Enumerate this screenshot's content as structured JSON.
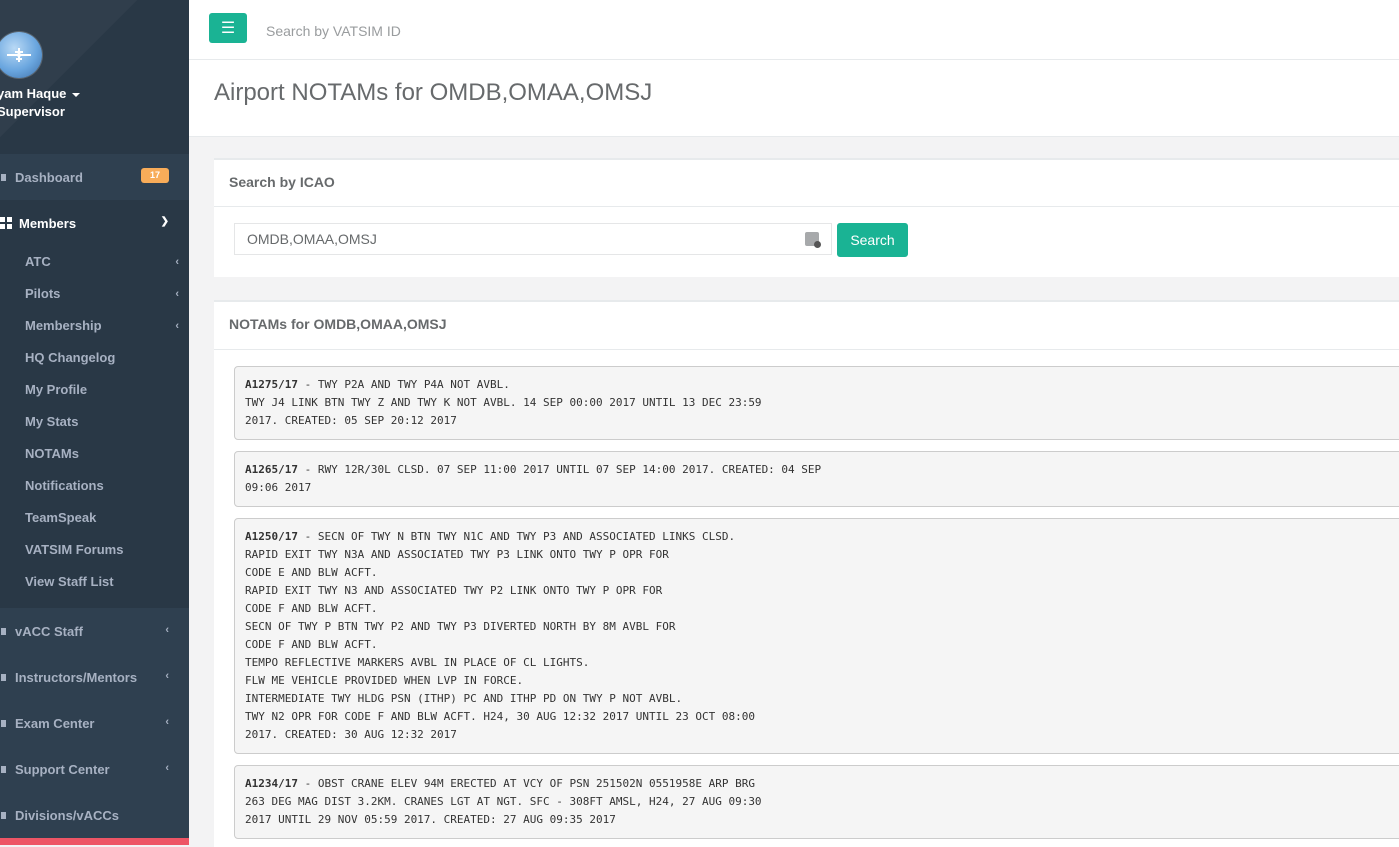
{
  "user": {
    "name": "yam Haque",
    "role": "Supervisor"
  },
  "sidebar": {
    "dashboard": {
      "label": "Dashboard",
      "badge": "17"
    },
    "members": {
      "label": "Members"
    },
    "members_items": [
      {
        "label": "ATC",
        "has_submenu": true
      },
      {
        "label": "Pilots",
        "has_submenu": true
      },
      {
        "label": "Membership",
        "has_submenu": true
      },
      {
        "label": "HQ Changelog",
        "has_submenu": false
      },
      {
        "label": "My Profile",
        "has_submenu": false
      },
      {
        "label": "My Stats",
        "has_submenu": false
      },
      {
        "label": "NOTAMs",
        "has_submenu": false
      },
      {
        "label": "Notifications",
        "has_submenu": false
      },
      {
        "label": "TeamSpeak",
        "has_submenu": false
      },
      {
        "label": "VATSIM Forums",
        "has_submenu": false
      },
      {
        "label": "View Staff List",
        "has_submenu": false
      }
    ],
    "sections": [
      {
        "label": "vACC Staff"
      },
      {
        "label": "Instructors/Mentors"
      },
      {
        "label": "Exam Center"
      },
      {
        "label": "Support Center"
      },
      {
        "label": "Divisions/vACCs"
      }
    ]
  },
  "topbar": {
    "search_placeholder": "Search by VATSIM ID"
  },
  "page": {
    "title": "Airport NOTAMs for OMDB,OMAA,OMSJ"
  },
  "search_panel": {
    "title": "Search by ICAO",
    "input_value": "OMDB,OMAA,OMSJ",
    "button_label": "Search"
  },
  "notam_panel": {
    "title": "NOTAMs for OMDB,OMAA,OMSJ",
    "notams": [
      {
        "id": "A1275/17",
        "text": " - TWY P2A AND TWY P4A NOT AVBL.\nTWY J4 LINK BTN TWY Z AND TWY K NOT AVBL. 14 SEP 00:00 2017 UNTIL 13 DEC 23:59\n2017. CREATED: 05 SEP 20:12 2017"
      },
      {
        "id": "A1265/17",
        "text": " - RWY 12R/30L CLSD. 07 SEP 11:00 2017 UNTIL 07 SEP 14:00 2017. CREATED: 04 SEP\n09:06 2017"
      },
      {
        "id": "A1250/17",
        "text": " - SECN OF TWY N BTN TWY N1C AND TWY P3 AND ASSOCIATED LINKS CLSD.\nRAPID EXIT TWY N3A AND ASSOCIATED TWY P3 LINK ONTO TWY P OPR FOR\nCODE E AND BLW ACFT.\nRAPID EXIT TWY N3 AND ASSOCIATED TWY P2 LINK ONTO TWY P OPR FOR\nCODE F AND BLW ACFT.\nSECN OF TWY P BTN TWY P2 AND TWY P3 DIVERTED NORTH BY 8M AVBL FOR\nCODE F AND BLW ACFT.\nTEMPO REFLECTIVE MARKERS AVBL IN PLACE OF CL LIGHTS.\nFLW ME VEHICLE PROVIDED WHEN LVP IN FORCE.\nINTERMEDIATE TWY HLDG PSN (ITHP) PC AND ITHP PD ON TWY P NOT AVBL.\nTWY N2 OPR FOR CODE F AND BLW ACFT. H24, 30 AUG 12:32 2017 UNTIL 23 OCT 08:00\n2017. CREATED: 30 AUG 12:32 2017"
      },
      {
        "id": "A1234/17",
        "text": " - OBST CRANE ELEV 94M ERECTED AT VCY OF PSN 251502N 0551958E ARP BRG\n263 DEG MAG DIST 3.2KM. CRANES LGT AT NGT. SFC - 308FT AMSL, H24, 27 AUG 09:30\n2017 UNTIL 29 NOV 05:59 2017. CREATED: 27 AUG 09:35 2017"
      }
    ]
  },
  "colors": {
    "sidebar_bg": "#2f4050",
    "sidebar_active_bg": "#293846",
    "primary": "#1ab394",
    "badge": "#f8ac59",
    "danger": "#ed5565"
  }
}
